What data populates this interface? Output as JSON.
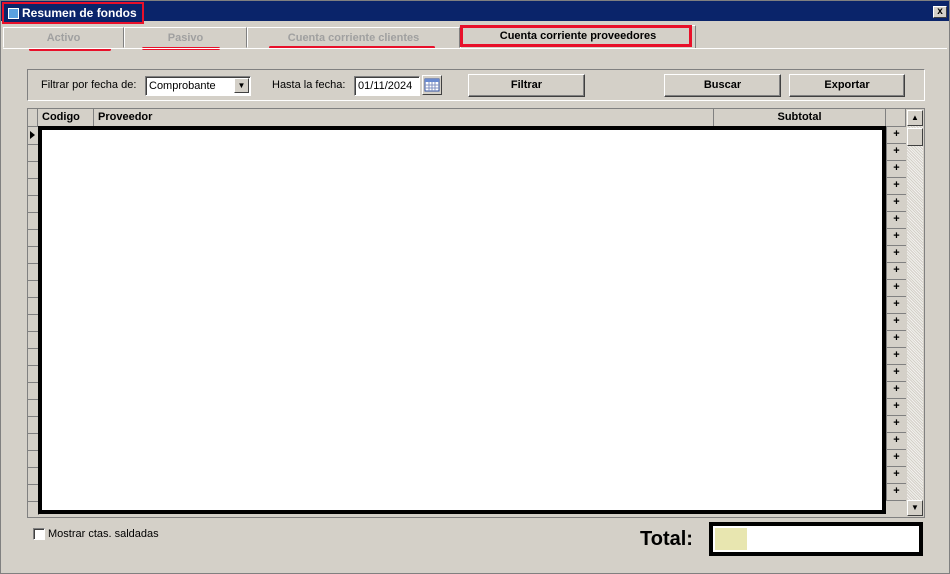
{
  "window": {
    "title": "Resumen de fondos",
    "close_glyph": "x"
  },
  "tabs": [
    {
      "label": "Activo",
      "active": false
    },
    {
      "label": "Pasivo",
      "active": false
    },
    {
      "label": "Cuenta corriente clientes",
      "active": false
    },
    {
      "label": "Cuenta corriente proveedores",
      "active": true
    }
  ],
  "filter": {
    "date_filter_label": "Filtrar por fecha de:",
    "date_filter_value": "Comprobante",
    "until_label": "Hasta la fecha:",
    "until_value": "01/11/2024",
    "filter_button": "Filtrar",
    "search_button": "Buscar",
    "export_button": "Exportar"
  },
  "grid": {
    "columns": [
      "Codigo",
      "Proveedor",
      "Subtotal"
    ],
    "expand_glyph": "+",
    "row_count": 22
  },
  "footer": {
    "show_settled_label": "Mostrar ctas. saldadas",
    "show_settled_checked": false,
    "total_label": "Total:",
    "total_value": ""
  },
  "colors": {
    "titlebar": "#0a246a",
    "highlight": "#e8102a",
    "face": "#d4d0c8"
  }
}
